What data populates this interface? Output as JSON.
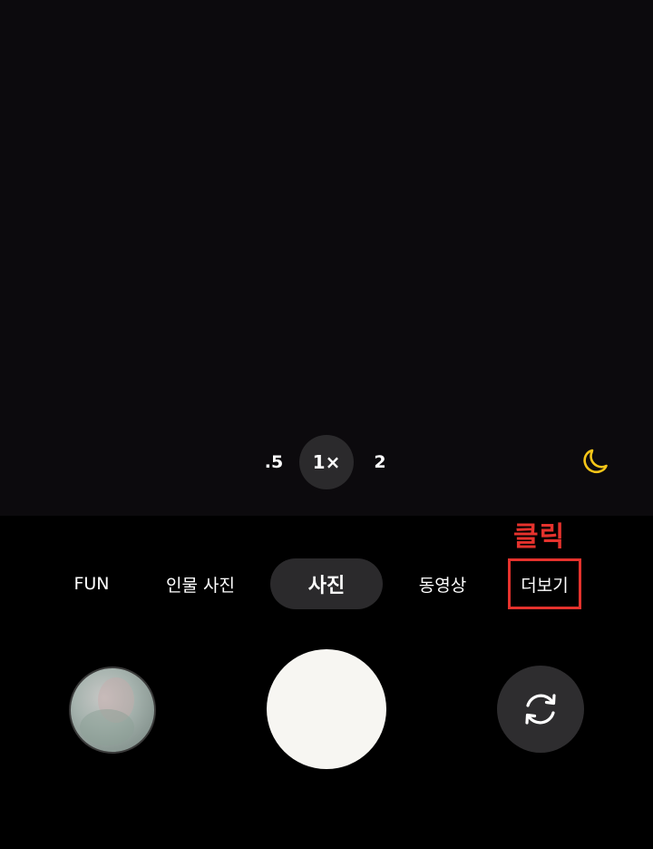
{
  "zoom": {
    "options": [
      ".5",
      "1×",
      "2"
    ],
    "selected": "1×"
  },
  "night_mode": {
    "icon": "moon-icon",
    "color": "#f5c518"
  },
  "annotation": {
    "text": "클릭",
    "color": "#e5322d"
  },
  "modes": {
    "items": [
      "FUN",
      "인물 사진",
      "사진",
      "동영상",
      "더보기"
    ],
    "selected": "사진",
    "highlighted": "더보기"
  },
  "controls": {
    "gallery_icon": "gallery-thumbnail",
    "shutter_icon": "shutter-button",
    "switch_icon": "camera-switch-icon"
  }
}
